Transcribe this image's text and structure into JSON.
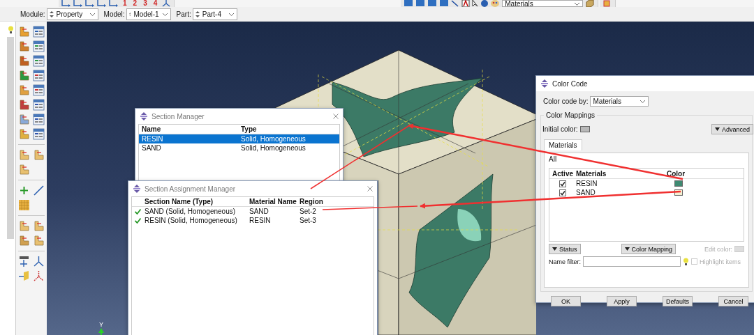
{
  "toolbar": {
    "view_buttons": [
      "1",
      "2",
      "3",
      "4"
    ],
    "render_style": "Materials"
  },
  "context_bar": {
    "fields": [
      {
        "label": "Module:",
        "value": "Property"
      },
      {
        "label": "Model:",
        "value": "Model-1"
      },
      {
        "label": "Part:",
        "value": "Part-4"
      }
    ]
  },
  "viewport": {
    "axis_label": "Y"
  },
  "section_manager": {
    "title": "Section Manager",
    "columns": [
      "Name",
      "Type"
    ],
    "rows": [
      {
        "name": "RESIN",
        "type": "Solid, Homogeneous",
        "selected": true
      },
      {
        "name": "SAND",
        "type": "Solid, Homogeneous",
        "selected": false
      }
    ]
  },
  "section_assignment_manager": {
    "title": "Section Assignment Manager",
    "columns": [
      "Section Name (Type)",
      "Material Name",
      "Region"
    ],
    "rows": [
      {
        "section": "SAND (Solid, Homogeneous)",
        "material": "SAND",
        "region": "Set-2",
        "valid": true
      },
      {
        "section": "RESIN (Solid, Homogeneous)",
        "material": "RESIN",
        "region": "Set-3",
        "valid": true
      }
    ]
  },
  "color_code": {
    "title": "Color Code",
    "color_code_by_label": "Color code by:",
    "color_code_by": "Materials",
    "group_title": "Color Mappings",
    "initial_color_label": "Initial color:",
    "advanced_button": "Advanced",
    "tabs": [
      {
        "label": "Materials",
        "selected": true
      }
    ],
    "tree_label": "All",
    "columns": [
      "Active",
      "Materials",
      "Color"
    ],
    "rows": [
      {
        "active": true,
        "name": "RESIN",
        "color": "#3f8a72"
      },
      {
        "active": true,
        "name": "SAND",
        "color": "#f4f0d2"
      }
    ],
    "status_button": "Status",
    "color_mapping_button": "Color Mapping",
    "edit_color_label": "Edit color:",
    "edit_color_disabled": true,
    "name_filter_label": "Name filter:",
    "highlight_items": {
      "label": "Highlight items",
      "checked": false,
      "disabled": true
    },
    "buttons": [
      "OK",
      "Apply",
      "Defaults",
      "Cancel"
    ]
  }
}
